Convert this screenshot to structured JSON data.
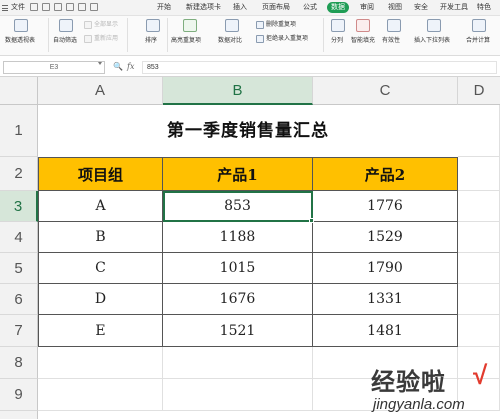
{
  "menubar": {
    "items": [
      "文件",
      "开始",
      "新建选项卡",
      "插入",
      "页面布局",
      "公式",
      "数据",
      "审阅",
      "视图",
      "安全",
      "开发工具",
      "特色"
    ],
    "active": "数据",
    "accent": "#1f9d55"
  },
  "ribbon": {
    "pivot": "数据透视表",
    "autofilter": "自动筛选",
    "show_all": "全部显示",
    "reapply": "重新应用",
    "sort": "排序",
    "highlight_dup": "高亮重复项",
    "compare": "数据对比",
    "remove_dup": "删除重复项",
    "reject_dup": "拒绝录入重复项",
    "split": "分列",
    "smart_fill": "智能填充",
    "validity": "有效性",
    "dropdown": "插入下拉列表",
    "consolidate": "合并计算"
  },
  "formula_bar": {
    "cell_ref": "E3",
    "fx": "fx",
    "value": "853"
  },
  "grid": {
    "columns": [
      "A",
      "B",
      "C",
      "D"
    ],
    "selected_column": "B",
    "rows": [
      "1",
      "2",
      "3",
      "4",
      "5",
      "6",
      "7",
      "8",
      "9"
    ],
    "selected_row": "3"
  },
  "table": {
    "title": "第一季度销售量汇总",
    "headers": [
      "项目组",
      "产品1",
      "产品2"
    ],
    "header_color": "#ffc000",
    "rows": [
      [
        "A",
        "853",
        "1776"
      ],
      [
        "B",
        "1188",
        "1529"
      ],
      [
        "C",
        "1015",
        "1790"
      ],
      [
        "D",
        "1676",
        "1331"
      ],
      [
        "E",
        "1521",
        "1481"
      ]
    ]
  },
  "watermark": {
    "logo": "经验啦",
    "check": "√",
    "url": "jingyanla.com"
  }
}
